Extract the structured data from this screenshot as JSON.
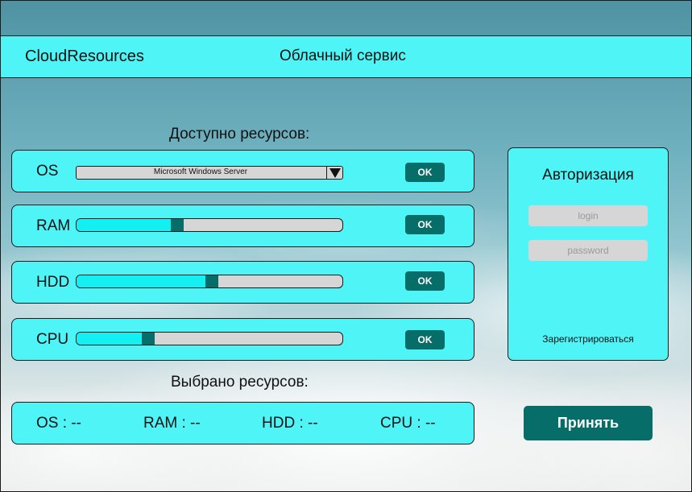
{
  "header": {
    "brand": "CloudResources",
    "subtitle": "Облачный сервис"
  },
  "available": {
    "title": "Доступно ресурсов:",
    "os": {
      "label": "OS",
      "selected": "Microsoft Windows Server",
      "button": "OK"
    },
    "ram": {
      "label": "RAM",
      "level": 0.38,
      "button": "OK"
    },
    "hdd": {
      "label": "HDD",
      "level": 0.51,
      "button": "OK"
    },
    "cpu": {
      "label": "CPU",
      "level": 0.27,
      "button": "OK"
    }
  },
  "selected": {
    "title": "Выбрано ресурсов:",
    "os": "OS : --",
    "ram": "RAM : --",
    "hdd": "HDD : --",
    "cpu": "CPU : --"
  },
  "auth": {
    "title": "Авторизация",
    "login_placeholder": "login",
    "password_placeholder": "password",
    "register": "Зарегистрироваться"
  },
  "accept_button": "Принять",
  "colors": {
    "panel": "#4ff4f7",
    "accent": "#066d68",
    "slider_fill": "#14f0f2",
    "track": "#d6d6d6"
  }
}
